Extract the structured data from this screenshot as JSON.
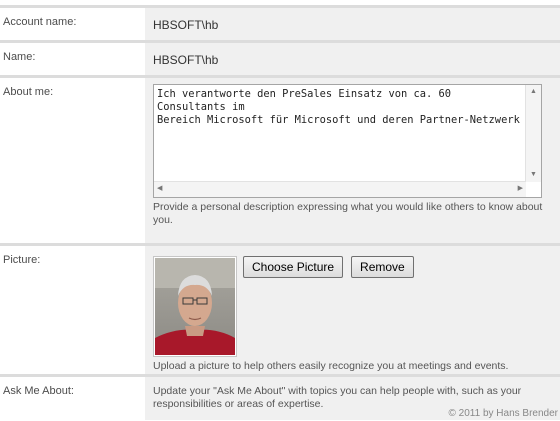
{
  "account": {
    "label": "Account name:",
    "value": "HBSOFT\\hb"
  },
  "name": {
    "label": "Name:",
    "value": "HBSOFT\\hb"
  },
  "about": {
    "label": "About me:",
    "text": "Ich verantworte den PreSales Einsatz von ca. 60 Consultants im\nBereich Microsoft für Microsoft und deren Partner-Netzwerk",
    "help": "Provide a personal description expressing what you would like others to know about you."
  },
  "picture": {
    "label": "Picture:",
    "choose_label": "Choose Picture",
    "remove_label": "Remove",
    "help": "Upload a picture to help others easily recognize you at meetings and events."
  },
  "ask": {
    "label": "Ask Me About:",
    "help": "Update your \"Ask Me About\" with topics you can help people with, such as your responsibilities or areas of expertise."
  },
  "footer": "© 2011 by Hans Brender",
  "colors": {
    "row_border": "#dcdcdc",
    "field_bg": "#f0f0f0",
    "label_text": "#4c4c4c"
  }
}
